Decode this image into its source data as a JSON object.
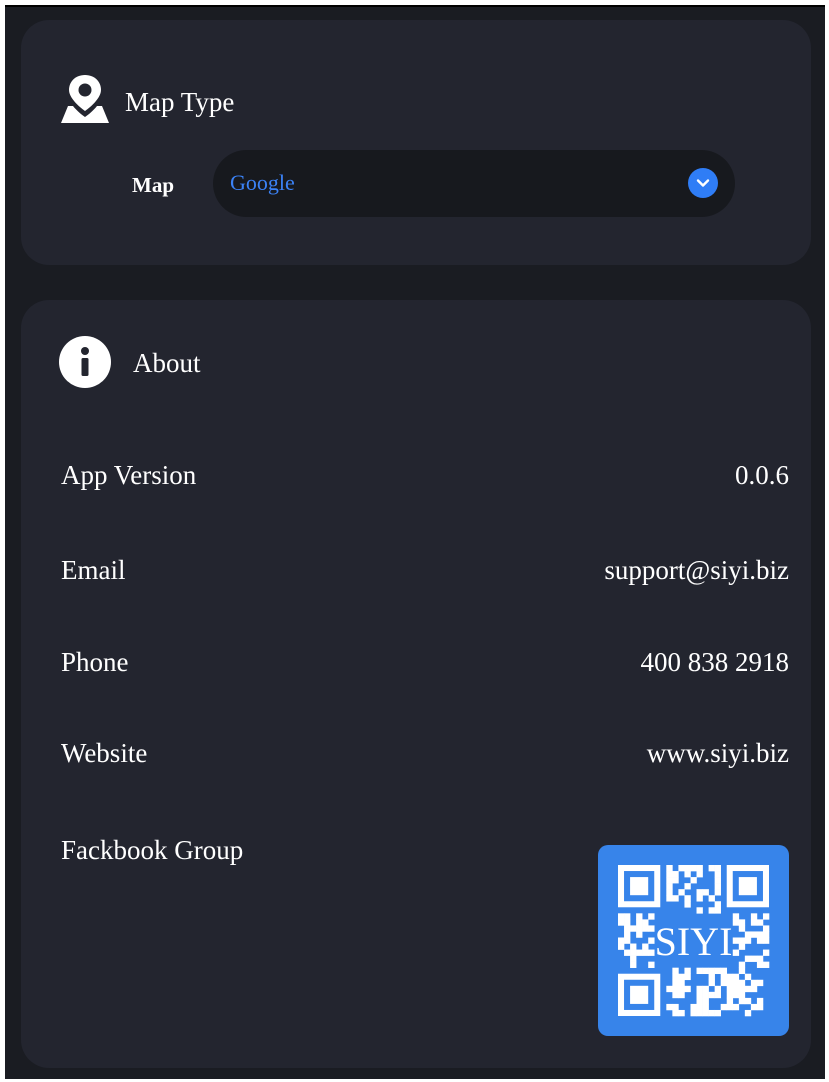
{
  "map_card": {
    "title": "Map Type",
    "map_label": "Map",
    "map_value": "Google",
    "icon": "map-pin-icon"
  },
  "about_card": {
    "title": "About",
    "icon": "info-icon",
    "rows": [
      {
        "label": "App Version",
        "value": "0.0.6"
      },
      {
        "label": "Email",
        "value": "support@siyi.biz"
      },
      {
        "label": "Phone",
        "value": "400 838 2918"
      },
      {
        "label": "Website",
        "value": "www.siyi.biz"
      },
      {
        "label": "Fackbook Group"
      }
    ],
    "qr_text": "SIYI"
  },
  "colors": {
    "background": "#1a1c22",
    "card": "#23252f",
    "select_bg": "#17191e",
    "accent": "#3b82f6",
    "qr_bg": "#3784ea",
    "text": "#ffffff"
  }
}
